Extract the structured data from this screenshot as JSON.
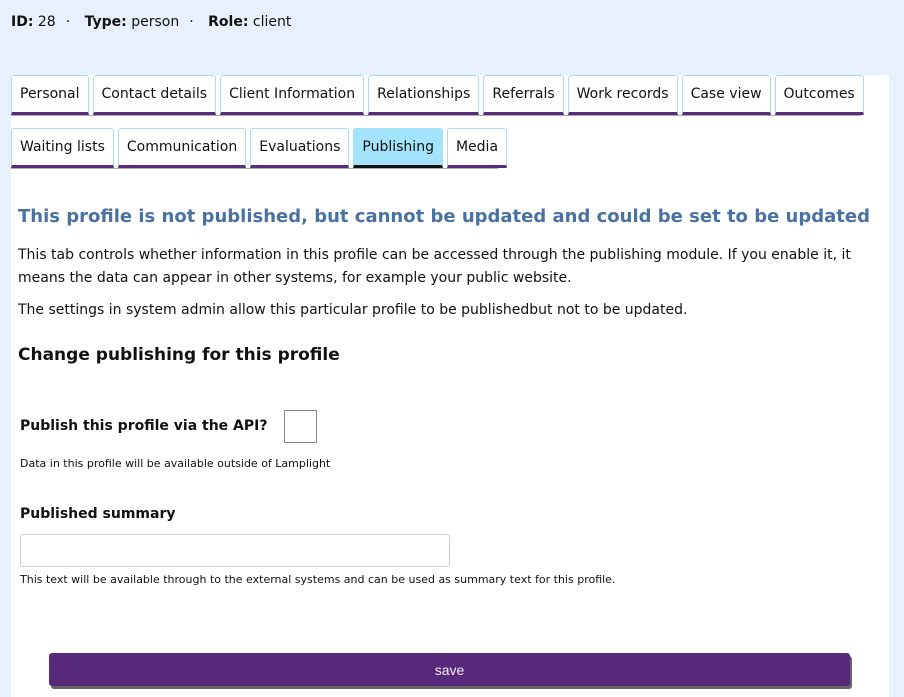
{
  "header": {
    "id_label": "ID:",
    "id": "28",
    "type_label": "Type:",
    "type": "person",
    "role_label": "Role:",
    "role": "client"
  },
  "tabs_row1": [
    "Personal",
    "Contact details",
    "Client Information",
    "Relationships",
    "Referrals",
    "Work records",
    "Case view",
    "Outcomes"
  ],
  "tabs_row2": [
    "Waiting lists",
    "Communication",
    "Evaluations",
    "Publishing",
    "Media"
  ],
  "active_tab": "Publishing",
  "status_heading": "This profile is not published, but cannot be updated and could be set to be updated",
  "intro": "This tab controls whether information in this profile can be accessed through the publishing module. If you enable it, it means the data can appear in other systems, for example your public website.",
  "settings_note": "The settings in system admin allow this particular profile to be publishedbut not to be updated.",
  "section_heading": "Change publishing for this profile",
  "publish": {
    "label": "Publish this profile via the API?",
    "checked": false,
    "help": "Data in this profile will be available outside of Lamplight"
  },
  "summary": {
    "label": "Published summary",
    "value": "",
    "help": "This text will be available through to the external systems and can be used as summary text for this profile."
  },
  "save_label": "save",
  "colors": {
    "accent": "#58287b",
    "active_tab": "#a3e3fb",
    "heading": "#4a72a0"
  }
}
